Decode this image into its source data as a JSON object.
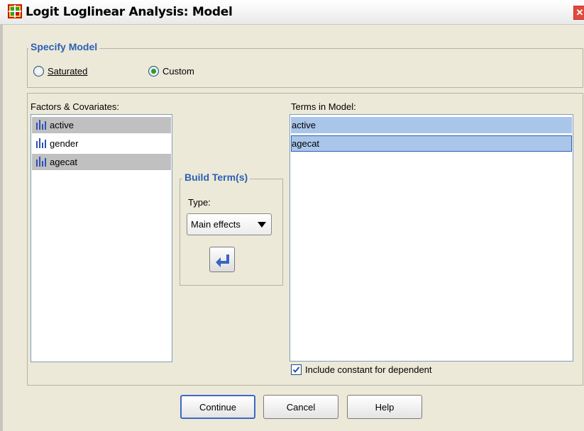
{
  "window": {
    "title": "Logit Loglinear Analysis: Model",
    "close_glyph": "✕"
  },
  "specify_model": {
    "legend": "Specify Model",
    "options": [
      {
        "label": "Saturated",
        "selected": false
      },
      {
        "label": "Custom",
        "selected": true
      }
    ]
  },
  "factors": {
    "label": "Factors & Covariates:",
    "items": [
      {
        "label": "active",
        "selected": true
      },
      {
        "label": "gender",
        "selected": false
      },
      {
        "label": "agecat",
        "selected": true
      }
    ]
  },
  "build_terms": {
    "legend": "Build Term(s)",
    "type_label": "Type:",
    "type_value": "Main effects"
  },
  "terms": {
    "label": "Terms in Model:",
    "items": [
      {
        "label": "active",
        "selected": true
      },
      {
        "label": "agecat",
        "selected": true,
        "focused": true
      }
    ]
  },
  "include_constant": {
    "label": "Include constant for dependent",
    "checked": true
  },
  "buttons": {
    "continue": "Continue",
    "cancel": "Cancel",
    "help": "Help"
  },
  "icons": {
    "app": "spss-dialog-icon",
    "variable": "nominal-variable-icon",
    "move": "move-left-arrow-icon",
    "dropdown": "triangle-down-icon"
  },
  "colors": {
    "dialog_bg": "#ece9d8",
    "legend_text": "#2b5fb4",
    "selected_item": "#c0c0c0",
    "term_selected": "#a9c6ea",
    "focus_border": "#2b5fb4"
  }
}
